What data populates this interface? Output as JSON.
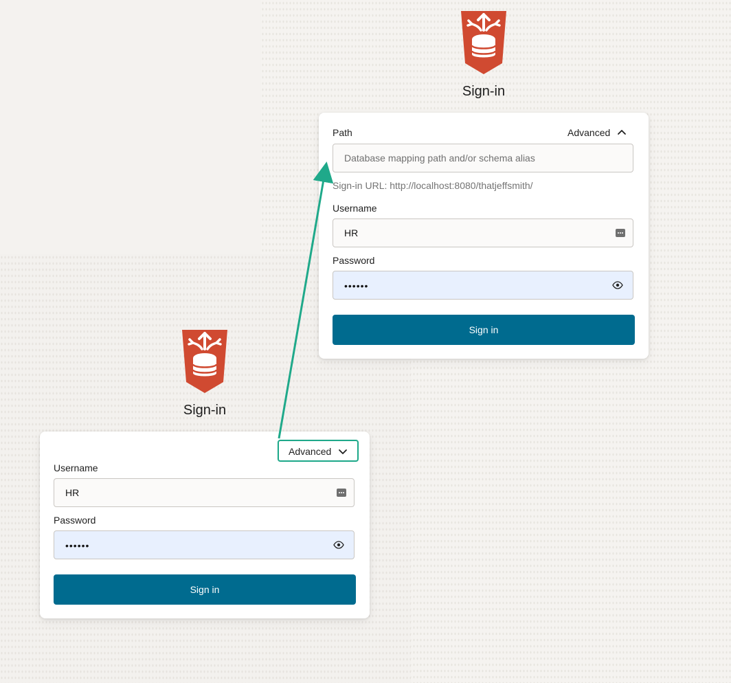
{
  "expanded_view": {
    "title": "Sign-in",
    "advanced_label": "Advanced",
    "path_label": "Path",
    "path_placeholder": "Database mapping path and/or schema alias",
    "signin_url": "Sign-in URL: http://localhost:8080/thatjeffsmith/",
    "username_label": "Username",
    "username_value": "HR",
    "password_label": "Password",
    "password_value": "••••••",
    "button_label": "Sign in"
  },
  "collapsed_view": {
    "title": "Sign-in",
    "advanced_label": "Advanced",
    "username_label": "Username",
    "username_value": "HR",
    "password_label": "Password",
    "password_value": "••••••",
    "button_label": "Sign in"
  },
  "colors": {
    "brand_red": "#d04a31",
    "button_blue": "#006b8f",
    "highlight_green": "#1fa98a",
    "password_field_fill": "#e8f0fe"
  },
  "icons": {
    "logo": "database-api-shield-icon",
    "username_field": "password-manager-icon",
    "password_field": "eye-icon",
    "advanced_expanded": "chevron-up-icon",
    "advanced_collapsed": "chevron-down-icon"
  }
}
